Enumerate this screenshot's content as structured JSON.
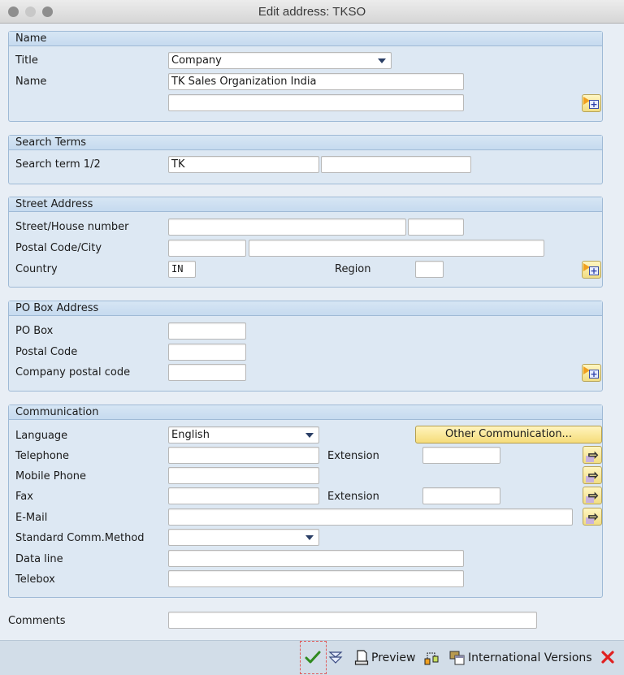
{
  "window": {
    "title": "Edit address:  TKSO"
  },
  "name_group": {
    "header": "Name",
    "title_label": "Title",
    "title_value": "Company",
    "name_label": "Name",
    "name_value": "TK Sales Organization India",
    "name2_value": "",
    "more_icon": "more-fields-icon"
  },
  "search_group": {
    "header": "Search Terms",
    "term_label": "Search term 1/2",
    "term1_value": "TK",
    "term2_value": ""
  },
  "street_group": {
    "header": "Street Address",
    "street_label": "Street/House number",
    "street_value": "",
    "house_value": "",
    "postal_label": "Postal Code/City",
    "postal_value": "",
    "city_value": "",
    "country_label": "Country",
    "country_value": "IN",
    "region_label": "Region",
    "region_value": ""
  },
  "pobox_group": {
    "header": "PO Box Address",
    "pobox_label": "PO Box",
    "pobox_value": "",
    "postal_label": "Postal Code",
    "postal_value": "",
    "company_postal_label": "Company postal code",
    "company_postal_value": ""
  },
  "comm_group": {
    "header": "Communication",
    "language_label": "Language",
    "language_value": "English",
    "other_comm_button": "Other Communication...",
    "telephone_label": "Telephone",
    "telephone_value": "",
    "extension_label": "Extension",
    "telephone_ext_value": "",
    "mobile_label": "Mobile Phone",
    "mobile_value": "",
    "fax_label": "Fax",
    "fax_value": "",
    "fax_ext_value": "",
    "email_label": "E-Mail",
    "email_value": "",
    "std_comm_label": "Standard Comm.Method",
    "std_comm_value": "",
    "dataline_label": "Data line",
    "dataline_value": "",
    "telebox_label": "Telebox",
    "telebox_value": ""
  },
  "comments": {
    "label": "Comments",
    "value": ""
  },
  "toolbar": {
    "preview_label": "Preview",
    "international_label": "International Versions"
  }
}
